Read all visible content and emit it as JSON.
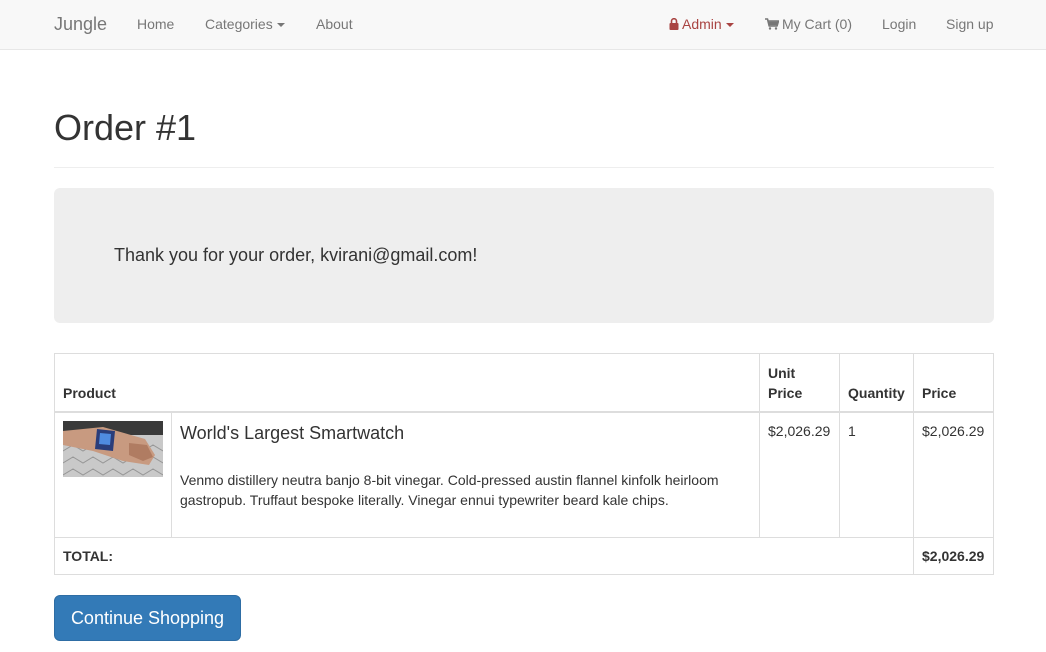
{
  "navbar": {
    "brand": "Jungle",
    "home": "Home",
    "categories": "Categories",
    "about": "About",
    "admin": "Admin",
    "cart": "My Cart (0)",
    "login": "Login",
    "signup": "Sign up"
  },
  "page": {
    "title": "Order #1",
    "thank_you": "Thank you for your order, kvirani@gmail.com!"
  },
  "table": {
    "headers": {
      "product": "Product",
      "unit_price": "Unit Price",
      "quantity": "Quantity",
      "price": "Price"
    },
    "rows": [
      {
        "name": "World's Largest Smartwatch",
        "description": "Venmo distillery neutra banjo 8-bit vinegar. Cold-pressed austin flannel kinfolk heirloom gastropub. Truffaut bespoke literally. Vinegar ennui typewriter beard kale chips.",
        "unit_price": "$2,026.29",
        "quantity": "1",
        "price": "$2,026.29"
      }
    ],
    "total_label": "TOTAL:",
    "total_value": "$2,026.29"
  },
  "actions": {
    "continue_shopping": "Continue Shopping"
  },
  "colors": {
    "navbar_bg": "#f8f8f8",
    "admin": "#a94442",
    "button": "#337ab7",
    "jumbotron": "#eeeeee"
  },
  "icons": {
    "admin": "lock-icon",
    "cart": "shopping-cart-icon"
  }
}
